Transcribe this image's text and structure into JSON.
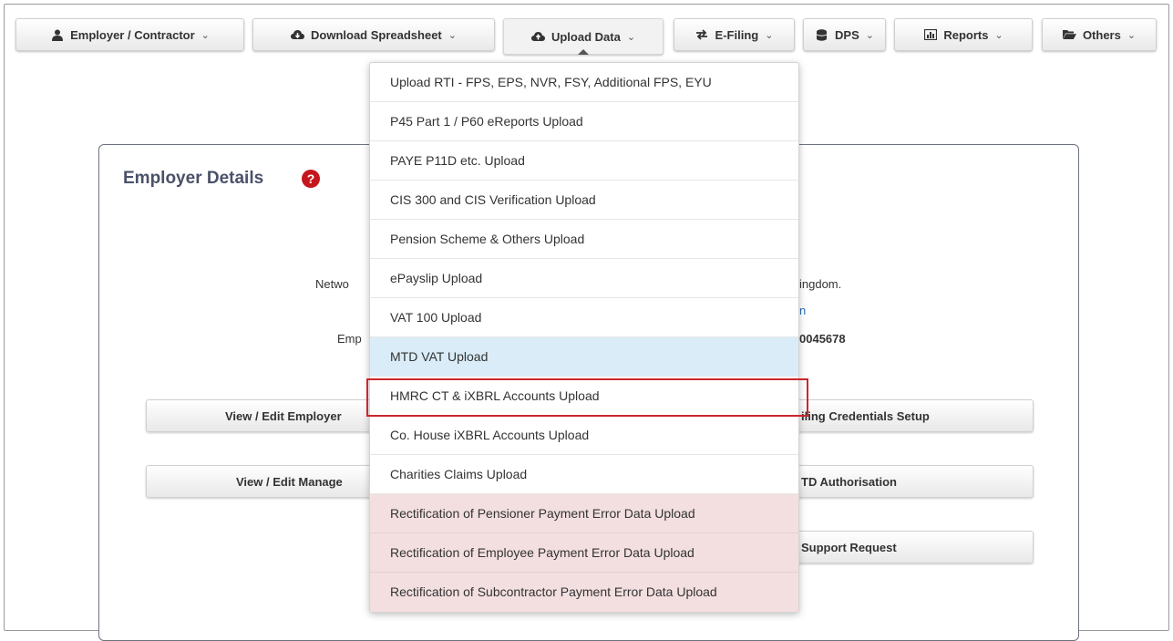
{
  "nav": {
    "items": [
      {
        "label": "Employer / Contractor",
        "icon": "user-icon"
      },
      {
        "label": "Download Spreadsheet",
        "icon": "cloud-download-icon"
      },
      {
        "label": "Upload Data",
        "icon": "cloud-upload-icon"
      },
      {
        "label": "E-Filing",
        "icon": "exchange-icon"
      },
      {
        "label": "DPS",
        "icon": "database-icon"
      },
      {
        "label": "Reports",
        "icon": "chart-icon"
      },
      {
        "label": "Others",
        "icon": "folder-open-icon"
      }
    ],
    "caret": "⌄",
    "active_index": 2
  },
  "dropdown": {
    "items": [
      {
        "label": "Upload RTI - FPS, EPS, NVR, FSY, Additional FPS, EYU"
      },
      {
        "label": "P45 Part 1 / P60 eReports Upload"
      },
      {
        "label": "PAYE P11D etc. Upload"
      },
      {
        "label": "CIS 300 and CIS Verification Upload"
      },
      {
        "label": "Pension Scheme & Others Upload"
      },
      {
        "label": "ePayslip Upload"
      },
      {
        "label": "VAT 100 Upload"
      },
      {
        "label": "MTD VAT Upload"
      },
      {
        "label": "HMRC CT & iXBRL Accounts Upload"
      },
      {
        "label": "Co. House iXBRL Accounts Upload"
      },
      {
        "label": "Charities Claims Upload"
      },
      {
        "label": "Rectification of Pensioner Payment Error Data Upload"
      },
      {
        "label": "Rectification of Employee Payment Error Data Upload"
      },
      {
        "label": "Rectification of Subcontractor Payment Error Data Upload"
      }
    ],
    "hover_index": 7,
    "outlined_index": 8
  },
  "panel": {
    "title": "Employer Details",
    "help_glyph": "?",
    "fragments": {
      "netwo": "Netwo",
      "ingdom": "ingdom.",
      "link_n": "n",
      "emp": "Emp",
      "number": "0045678"
    },
    "buttons": {
      "view_edit_employer": "View / Edit Employer",
      "filing_credentials": "iling Credentials Setup",
      "view_edit_manage": "View / Edit Manage",
      "mtd_authorisation": "TD Authorisation",
      "support_request": "Support Request"
    }
  },
  "colors": {
    "hover_blue": "#d9ecf7",
    "error_pink": "#f3dfe0",
    "outline_red": "#c9282d",
    "help_red": "#c4161c",
    "title_navy": "#4a5168"
  }
}
